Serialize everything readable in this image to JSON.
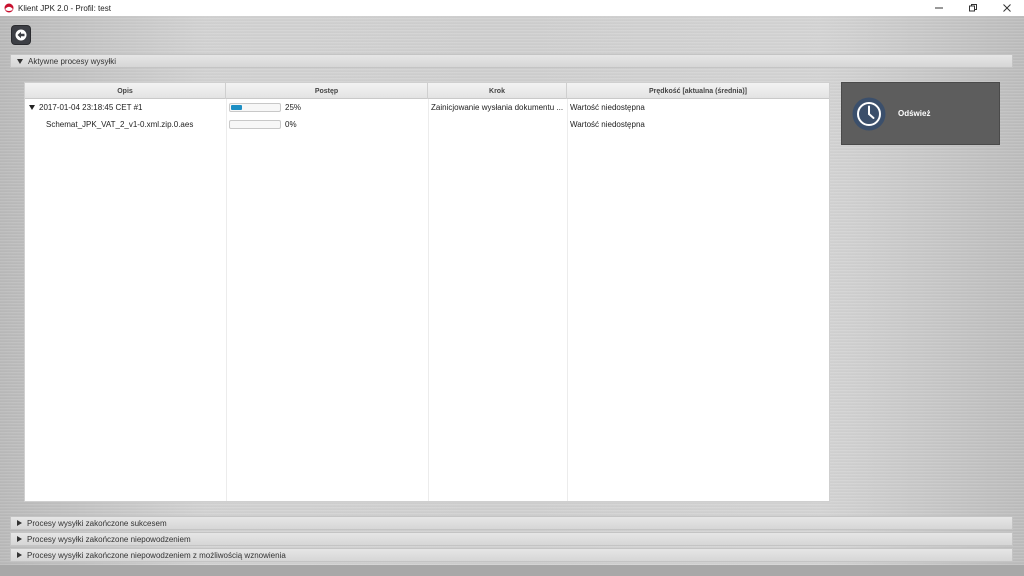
{
  "window": {
    "title": "Klient JPK 2.0 - Profil: test",
    "controls": [
      "minimize",
      "restore",
      "close"
    ]
  },
  "toolbar": {
    "back_icon": "arrow-left-icon"
  },
  "sections": {
    "active": {
      "label": "Aktywne procesy wysyłki",
      "expanded": true
    },
    "success": {
      "label": "Procesy wysyłki zakończone sukcesem",
      "expanded": false
    },
    "failure": {
      "label": "Procesy wysyłki zakończone niepowodzeniem",
      "expanded": false
    },
    "resumable": {
      "label": "Procesy wysyłki zakończone niepowodzeniem z możliwością wznowienia",
      "expanded": false
    }
  },
  "table": {
    "columns": [
      "Opis",
      "Postęp",
      "Krok",
      "Prędkość [aktualna (średnia)]"
    ],
    "rows": [
      {
        "description": "2017-01-04 23:18:45 CET #1",
        "progress": 25,
        "progress_label": "25%",
        "step": "Zainicjowanie wysłania dokumentu ...",
        "speed": "Wartość niedostępna",
        "expandable": true
      },
      {
        "description": "Schemat_JPK_VAT_2_v1-0.xml.zip.0.aes",
        "progress": 0,
        "progress_label": "0%",
        "step": "",
        "speed": "Wartość niedostępna",
        "expandable": false
      }
    ]
  },
  "refresh": {
    "label": "Odśwież",
    "icon": "clock-icon"
  },
  "colors": {
    "progress_fill": "#1d8fc4",
    "button_bg": "#5d5d5d",
    "icon_circle": "#3b4f6b"
  }
}
